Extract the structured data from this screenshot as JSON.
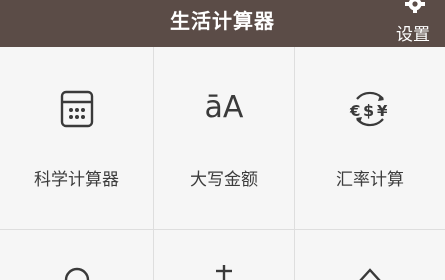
{
  "header": {
    "title": "生活计算器",
    "settings_label": "设置"
  },
  "tiles": [
    {
      "label": "科学计算器",
      "icon": "calculator-icon"
    },
    {
      "label": "大写金额",
      "icon": "uppercase-amount-icon",
      "icon_text": "āA"
    },
    {
      "label": "汇率计算",
      "icon": "exchange-rate-icon",
      "icon_text": "€$¥"
    }
  ],
  "colors": {
    "header_bg": "#5b4c47",
    "tile_bg": "#f6f6f6",
    "divider": "#dedede",
    "text": "#3c3c3c"
  }
}
